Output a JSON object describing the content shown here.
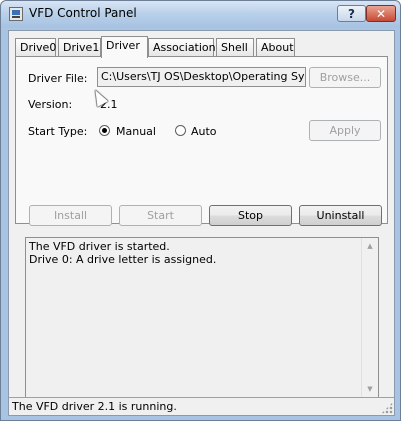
{
  "window": {
    "title": "VFD Control Panel",
    "help_label": "?",
    "close_label": "✕"
  },
  "tabs": [
    {
      "label": "Drive0",
      "active": false
    },
    {
      "label": "Drive1",
      "active": false
    },
    {
      "label": "Driver",
      "active": true
    },
    {
      "label": "Association",
      "active": false
    },
    {
      "label": "Shell",
      "active": false
    },
    {
      "label": "About",
      "active": false
    }
  ],
  "driver": {
    "file_label": "Driver File:",
    "file_value": "C:\\Users\\TJ OS\\Desktop\\Operating System",
    "browse_label": "Browse...",
    "version_label": "Version:",
    "version_value": "2.1",
    "start_type_label": "Start Type:",
    "radio_manual": "Manual",
    "radio_auto": "Auto",
    "selected_start_type": "Manual",
    "apply_label": "Apply"
  },
  "actions": {
    "install": "Install",
    "start": "Start",
    "stop": "Stop",
    "uninstall": "Uninstall"
  },
  "log": {
    "lines": [
      "The VFD driver is started.",
      "Drive 0: A drive letter is assigned."
    ]
  },
  "status": {
    "text": "The VFD driver 2.1 is running."
  },
  "colors": {
    "frame": "#a9c4e2",
    "close_button": "#c74a35",
    "disabled_text": "#a0a0a0"
  }
}
